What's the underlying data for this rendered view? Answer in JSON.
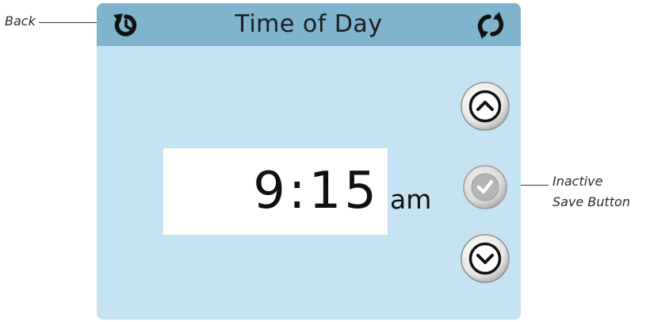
{
  "title": "Time of Day",
  "time": {
    "value": "9:15",
    "period": "am"
  },
  "callouts": {
    "back": "Back",
    "save_line1": "Inactive",
    "save_line2": "Save Button"
  },
  "icons": {
    "back": "back-icon",
    "refresh": "refresh-icon",
    "up": "chevron-up-icon",
    "save": "checkmark-icon",
    "down": "chevron-down-icon"
  },
  "colors": {
    "panel_background": "#c6e3f3",
    "titlebar_background": "#80b3cc",
    "display_background": "#ffffff",
    "inactive_button": "#b5b5b5"
  }
}
